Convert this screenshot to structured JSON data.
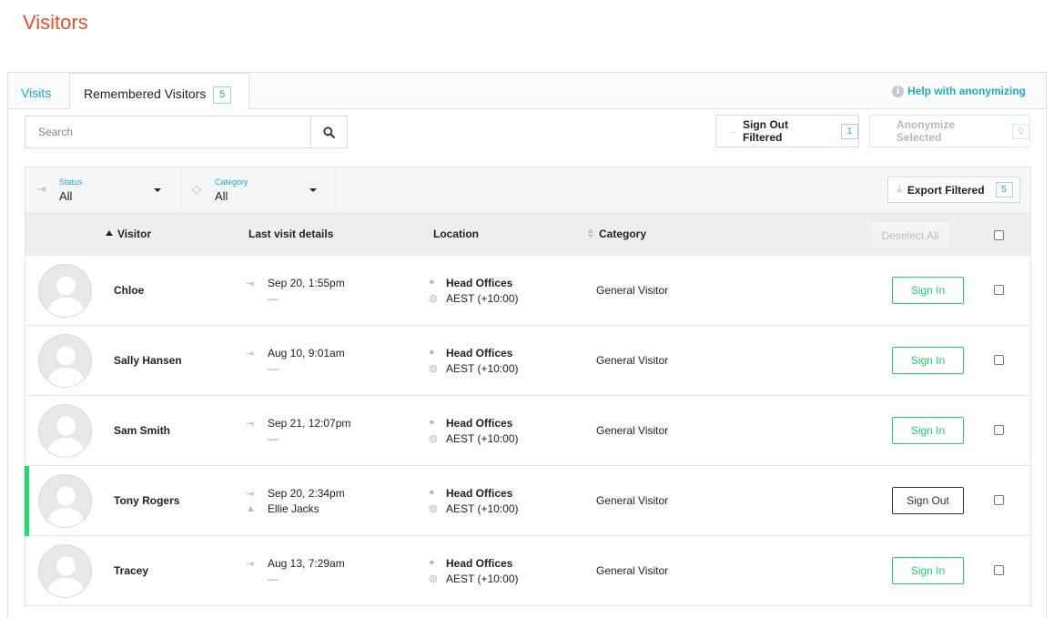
{
  "page": {
    "title": "Visitors"
  },
  "tabs": {
    "visits": "Visits",
    "remembered": "Remembered Visitors",
    "remembered_count": "5"
  },
  "help": {
    "label": "Help with anonymizing",
    "icon": "info-icon"
  },
  "search": {
    "placeholder": "Search",
    "icon": "search-icon"
  },
  "toolbar": {
    "sign_out_filtered": "Sign Out Filtered",
    "sign_out_filtered_count": "1",
    "anonymize_selected": "Anonymize Selected",
    "anonymize_selected_count": "0",
    "export_filtered": "Export Filtered",
    "export_filtered_count": "5"
  },
  "filters": {
    "status": {
      "label": "Status",
      "value": "All",
      "icon": "sign-in-icon"
    },
    "category": {
      "label": "Category",
      "value": "All",
      "icon": "tag-icon"
    }
  },
  "table": {
    "headers": {
      "visitor": "Visitor",
      "last_visit": "Last visit details",
      "location": "Location",
      "category": "Category"
    },
    "deselect_all": "Deselect All",
    "rows": [
      {
        "name": "Chloe",
        "visit_time": "Sep 20, 1:55pm",
        "visit_detail": "—",
        "location": "Head Offices",
        "timezone": "AEST (+10:00)",
        "category": "General Visitor",
        "action": "Sign In"
      },
      {
        "name": "Sally Hansen",
        "visit_time": "Aug 10, 9:01am",
        "visit_detail": "—",
        "location": "Head Offices",
        "timezone": "AEST (+10:00)",
        "category": "General Visitor",
        "action": "Sign In"
      },
      {
        "name": "Sam Smith",
        "visit_time": "Sep 21, 12:07pm",
        "visit_detail": "—",
        "location": "Head Offices",
        "timezone": "AEST (+10:00)",
        "category": "General Visitor",
        "action": "Sign In"
      },
      {
        "name": "Tony Rogers",
        "visit_time": "Sep 20, 2:34pm",
        "visit_detail": "Ellie Jacks",
        "location": "Head Offices",
        "timezone": "AEST (+10:00)",
        "category": "General Visitor",
        "action": "Sign Out"
      },
      {
        "name": "Tracey",
        "visit_time": "Aug 13, 7:29am",
        "visit_detail": "—",
        "location": "Head Offices",
        "timezone": "AEST (+10:00)",
        "category": "General Visitor",
        "action": "Sign In"
      }
    ]
  },
  "colors": {
    "title": "#e8502a",
    "accent": "#1fa9c7",
    "sign_in": "#1fcf6b",
    "signed_in_marker": "#19e06a"
  }
}
